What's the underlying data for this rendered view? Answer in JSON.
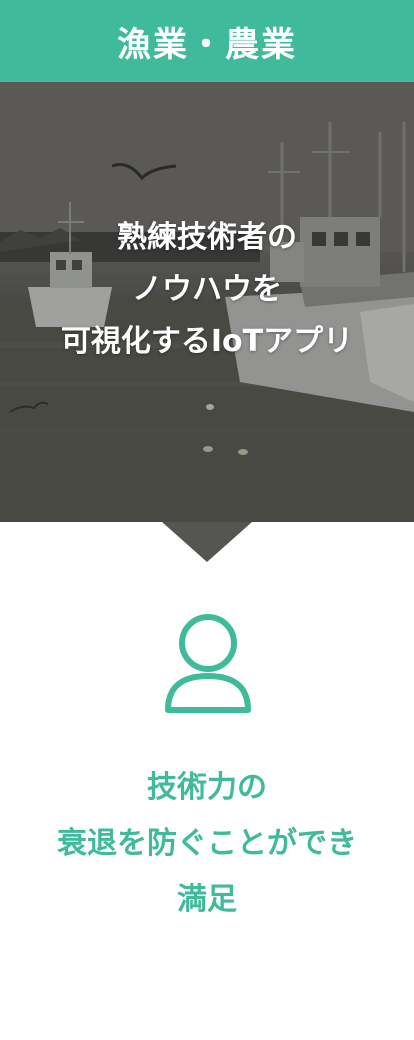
{
  "header": {
    "title": "漁業・農業"
  },
  "hero": {
    "lines": [
      "熟練技術者の",
      "ノウハウを",
      "可視化するIoTアプリ"
    ]
  },
  "result": {
    "lines": [
      "技術力の",
      "衰退を防ぐことができ",
      "満足"
    ]
  },
  "colors": {
    "accent": "#3fbb9c",
    "hero_overlay": "#555552",
    "text_light": "#ffffff"
  },
  "icons": {
    "person": "user-icon"
  }
}
